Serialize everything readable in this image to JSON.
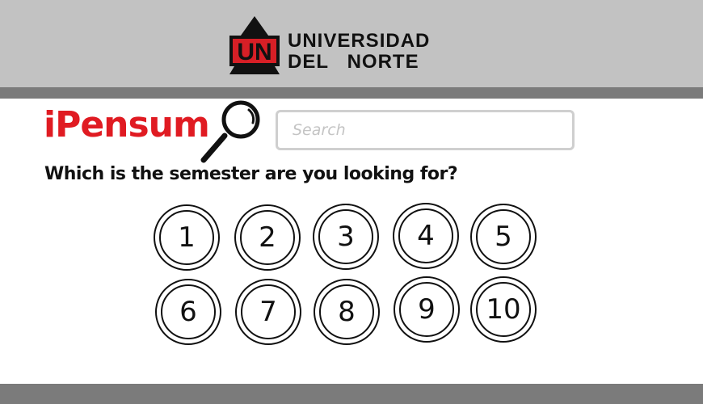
{
  "header": {
    "logo_mark": "UN",
    "logo_line_1": "UNIVERSIDAD",
    "logo_line_2": "DEL   NORTE",
    "background": "#c2c2c2",
    "stripe": "#7b7b7b"
  },
  "app": {
    "title": "iPensum",
    "accent": "#e01b22",
    "icon": "magnifier-icon"
  },
  "search": {
    "placeholder": "Search",
    "value": ""
  },
  "question": "Which is the semester are you looking for?",
  "semesters": [
    "1",
    "2",
    "3",
    "4",
    "5",
    "6",
    "7",
    "8",
    "9",
    "10"
  ]
}
